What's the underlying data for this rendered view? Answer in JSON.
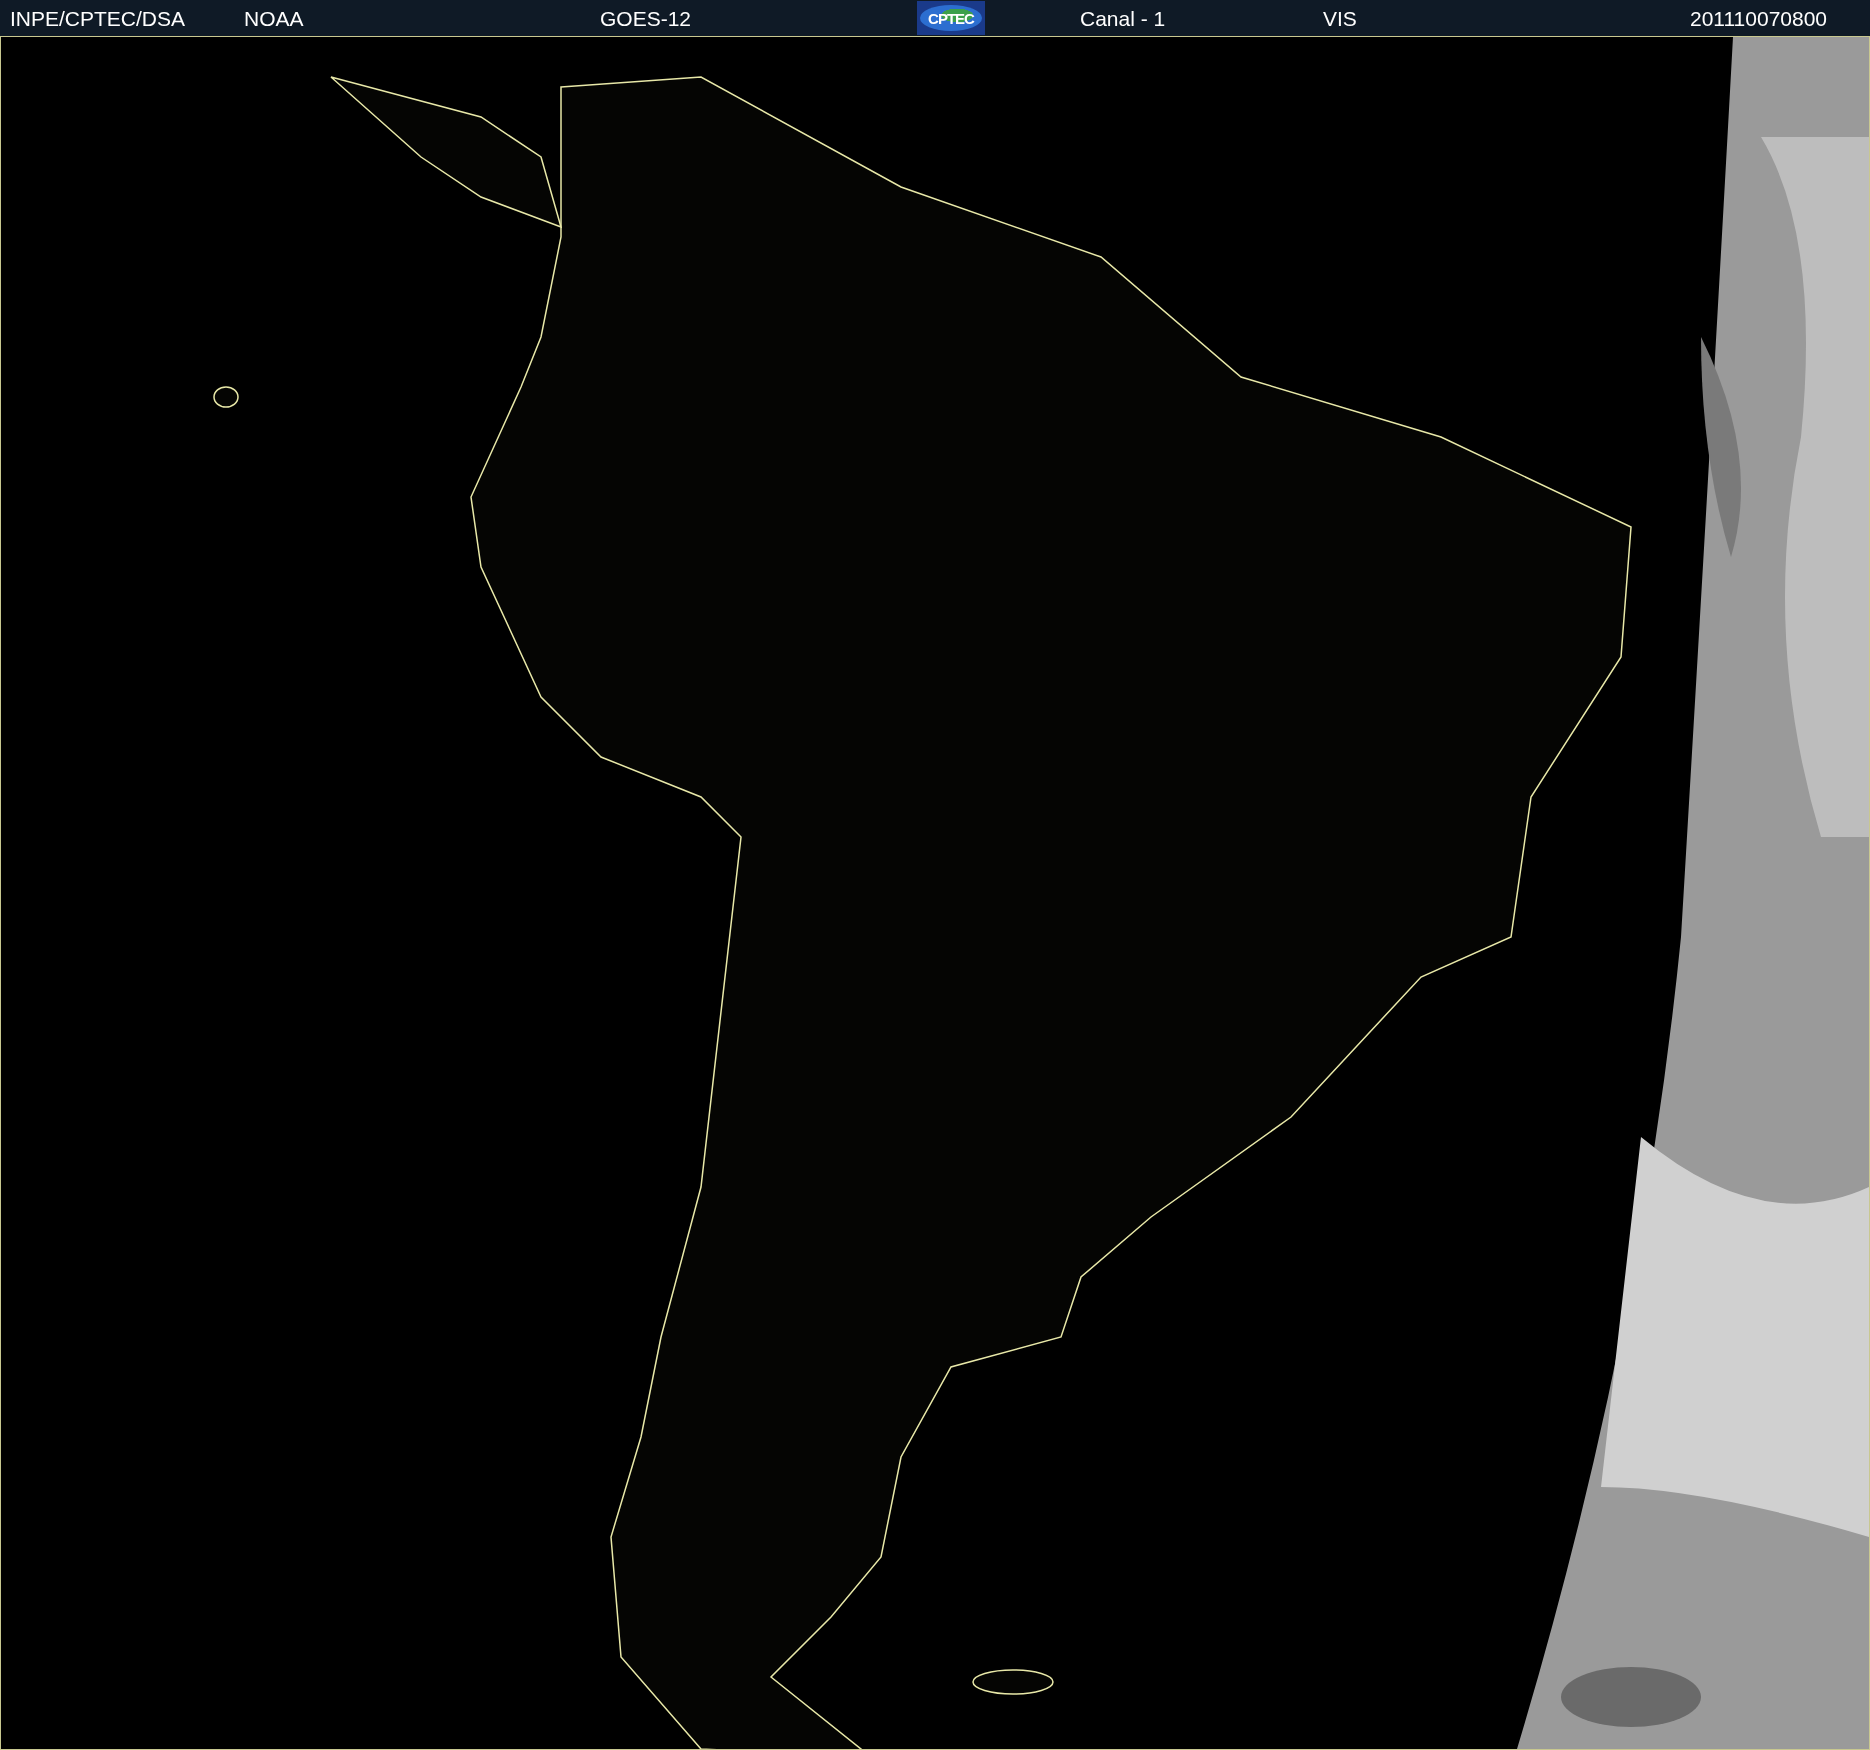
{
  "header": {
    "items": [
      {
        "kind": "text",
        "text": "INPE/CPTEC/DSA"
      },
      {
        "kind": "text",
        "text": "NOAA"
      },
      {
        "kind": "text",
        "text": "GOES-12"
      },
      {
        "kind": "logo",
        "text": "CPTEC"
      },
      {
        "kind": "text",
        "text": "Canal - 1"
      },
      {
        "kind": "text",
        "text": "VIS"
      },
      {
        "kind": "text",
        "text": "201110070800"
      }
    ]
  }
}
